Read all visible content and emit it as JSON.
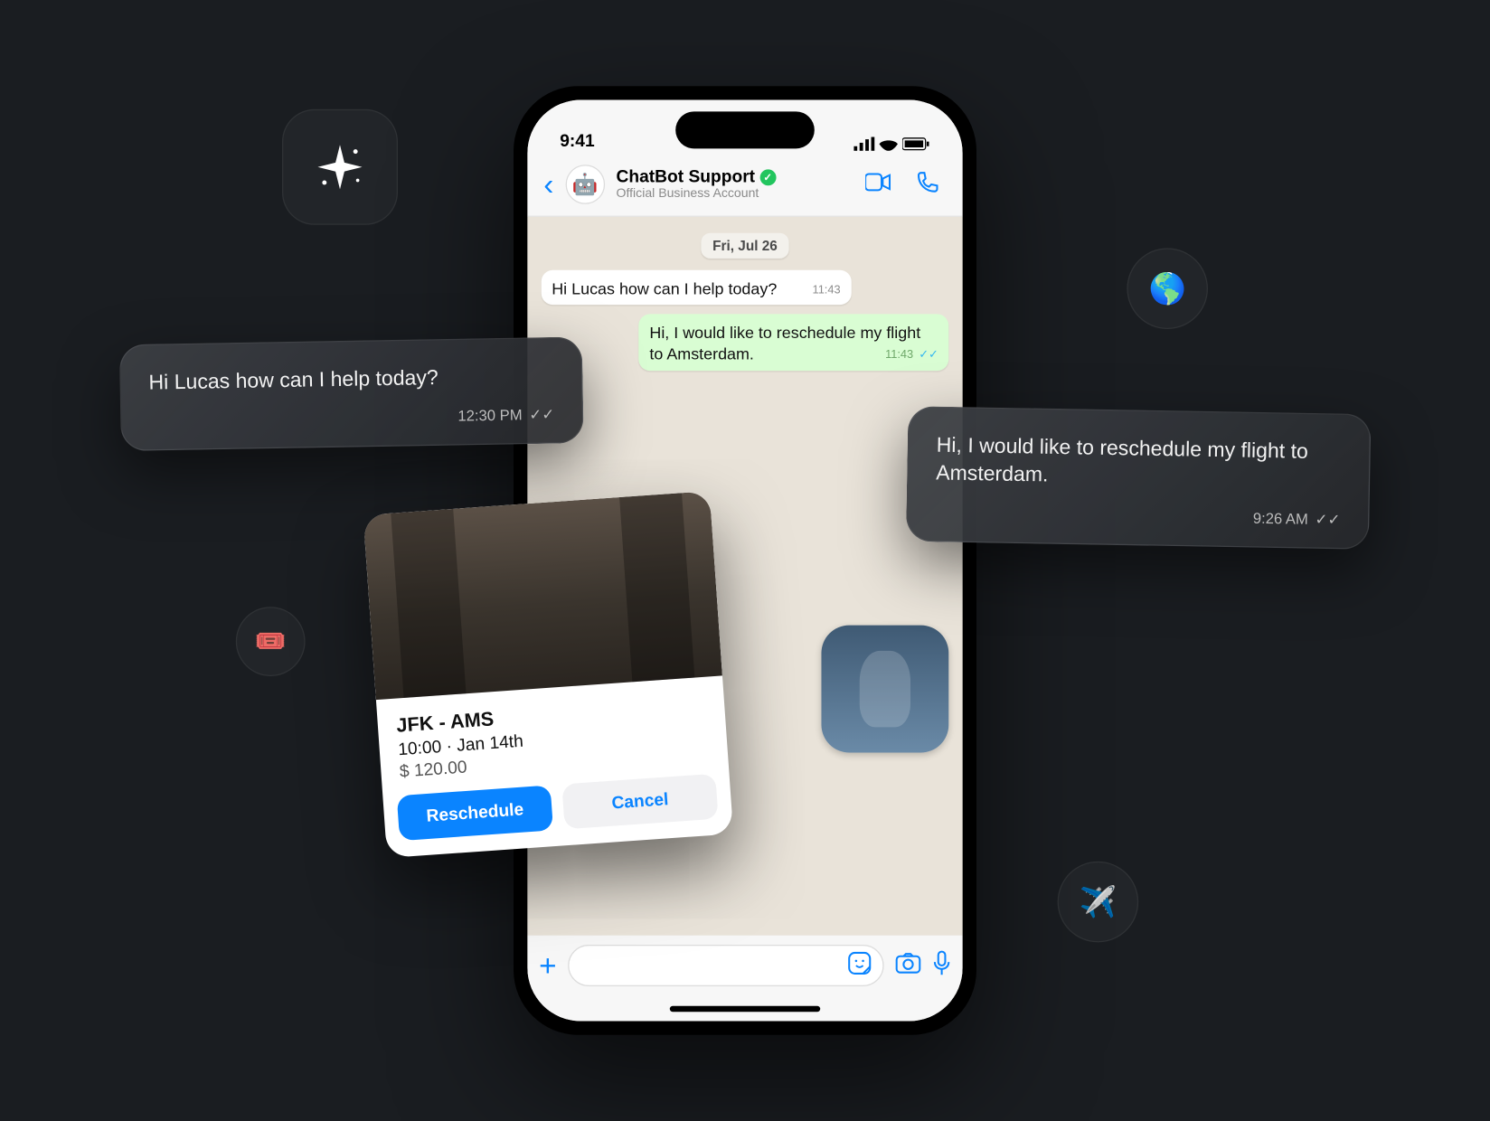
{
  "statusbar": {
    "time": "9:41"
  },
  "header": {
    "name": "ChatBot Support",
    "subtitle": "Official Business Account"
  },
  "chat": {
    "date_label": "Fri, Jul 26",
    "messages": [
      {
        "text": "Hi Lucas how can I help today?",
        "time": "11:43",
        "direction": "in"
      },
      {
        "text": "Hi, I would like to reschedule my flight to Amsterdam.",
        "time": "11:43",
        "direction": "out"
      }
    ]
  },
  "overlay_left": {
    "text": "Hi Lucas how can I help today?",
    "time": "12:30 PM"
  },
  "overlay_right": {
    "text": "Hi, I would like to reschedule my flight to Amsterdam.",
    "time": "9:26 AM"
  },
  "flight": {
    "route": "JFK - AMS",
    "time": "10:00 · Jan 14th",
    "price": "$ 120.00",
    "primary_label": "Reschedule",
    "secondary_label": "Cancel"
  },
  "deco": {
    "globe": "🌎",
    "ticket": "🎟️",
    "plane": "✈️"
  }
}
